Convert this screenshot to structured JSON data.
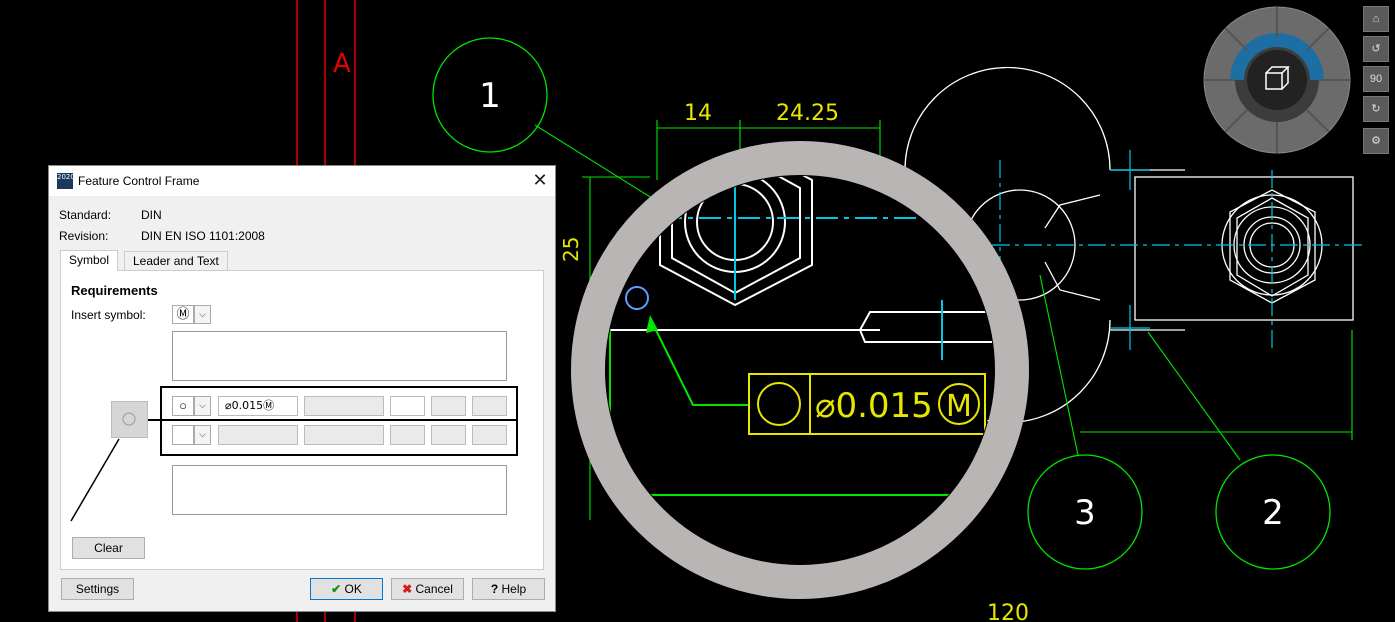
{
  "drawing": {
    "section_label": "A",
    "balloons": [
      "1",
      "2",
      "3"
    ],
    "dimensions": {
      "dim_14": "14",
      "dim_24_25": "24.25",
      "dim_25": "25",
      "dim_120": "120"
    },
    "magnified_frame": {
      "value": "⌀0.015",
      "modifier": "M"
    },
    "colors": {
      "background": "#000000",
      "geometry": "#ffffff",
      "center_lines": "#00c8e6",
      "leaders": "#00e600",
      "dimensions": "#e6e600",
      "section": "#e60000",
      "magnifier_ring": "#b9b5b4"
    }
  },
  "nav_cube": {
    "icons": [
      "home-icon",
      "rotate-left-icon",
      "rotate-90-icon",
      "rotate-right-icon",
      "gear-icon"
    ],
    "rotate_label": "90"
  },
  "dialog": {
    "title": "Feature Control Frame",
    "app_icon_label": "2020",
    "close_glyph": "✕",
    "standard_label": "Standard:",
    "standard_value": "DIN",
    "revision_label": "Revision:",
    "revision_value": "DIN EN ISO 1101:2008",
    "tabs": [
      {
        "label": "Symbol",
        "active": true
      },
      {
        "label": "Leader and Text",
        "active": false
      }
    ],
    "requirements_heading": "Requirements",
    "insert_symbol_label": "Insert symbol:",
    "insert_symbol_value": "Ⓜ",
    "row1": {
      "symbol": "○",
      "tolerance_value": "⌀0.015Ⓜ"
    },
    "clear_button": "Clear",
    "settings_button": "Settings",
    "ok_button": "OK",
    "cancel_button": "Cancel",
    "help_button": "Help"
  }
}
